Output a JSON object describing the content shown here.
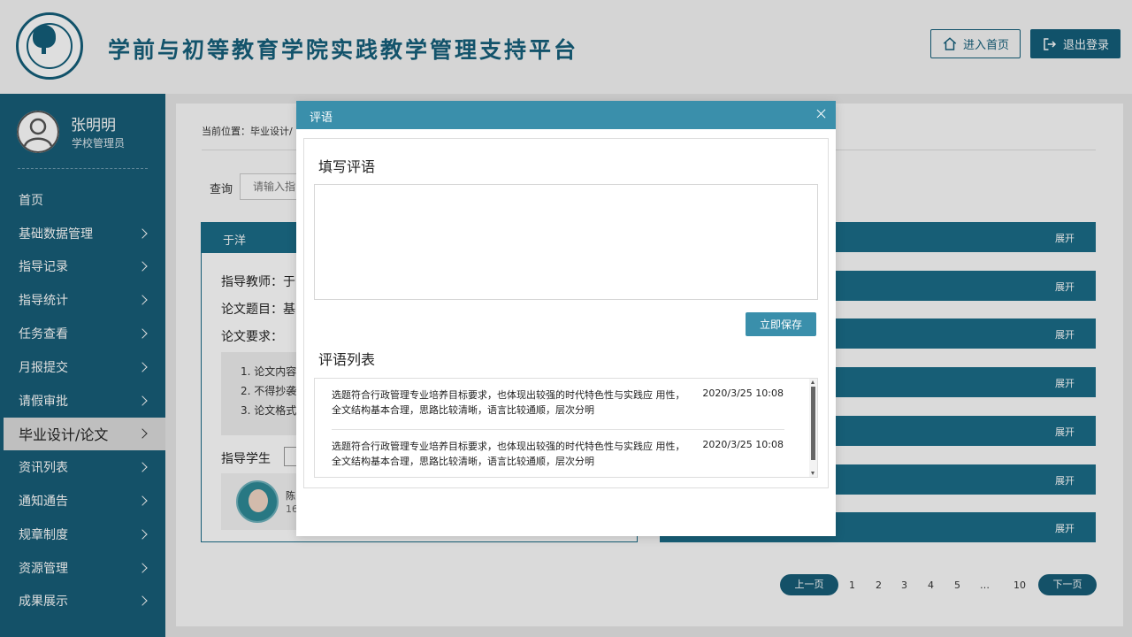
{
  "header": {
    "title": "学前与初等教育学院实践教学管理支持平台",
    "home_label": "进入首页",
    "logout_label": "退出登录"
  },
  "user": {
    "name": "张明明",
    "role": "学校管理员"
  },
  "nav": {
    "items": [
      {
        "label": "首页",
        "has_children": false,
        "active": false
      },
      {
        "label": "基础数据管理",
        "has_children": true,
        "active": false
      },
      {
        "label": "指导记录",
        "has_children": true,
        "active": false
      },
      {
        "label": "指导统计",
        "has_children": true,
        "active": false
      },
      {
        "label": "任务查看",
        "has_children": true,
        "active": false
      },
      {
        "label": "月报提交",
        "has_children": true,
        "active": false
      },
      {
        "label": "请假审批",
        "has_children": true,
        "active": false
      },
      {
        "label": "毕业设计/论文",
        "has_children": true,
        "active": true
      },
      {
        "label": "资讯列表",
        "has_children": true,
        "active": false
      },
      {
        "label": "通知通告",
        "has_children": true,
        "active": false
      },
      {
        "label": "规章制度",
        "has_children": true,
        "active": false
      },
      {
        "label": "资源管理",
        "has_children": true,
        "active": false
      },
      {
        "label": "成果展示",
        "has_children": true,
        "active": false
      }
    ]
  },
  "main": {
    "breadcrumb": "当前位置：毕业设计/",
    "query_label": "查询",
    "query_placeholder": "请输入指",
    "card": {
      "head": "于洋",
      "teacher": "指导教师：于",
      "topic": "论文题目：基",
      "requirement_label": "论文要求：",
      "requirements": [
        "1. 论文内容",
        "2. 不得抄袭",
        "3. 论文格式"
      ],
      "students_label": "指导学生",
      "student": {
        "name": "陈",
        "id": "16"
      }
    },
    "expand_label": "展开",
    "right_bar_count": 7,
    "pager": {
      "prev": "上一页",
      "next": "下一页",
      "pages": [
        "1",
        "2",
        "3",
        "4",
        "5",
        "…",
        "10"
      ]
    }
  },
  "modal": {
    "title": "评语",
    "write_title": "填写评语",
    "textarea_value": "",
    "save_label": "立即保存",
    "list_title": "评语列表",
    "comments": [
      {
        "text": "选题符合行政管理专业培养目标要求，也体现出较强的时代特色性与实践应 用性，全文结构基本合理，思路比较清晰，语言比较通顺，层次分明",
        "time": "2020/3/25 10:08"
      },
      {
        "text": "选题符合行政管理专业培养目标要求，也体现出较强的时代特色性与实践应 用性，全文结构基本合理，思路比较清晰，语言比较通顺，层次分明",
        "time": "2020/3/25 10:08"
      }
    ]
  },
  "colors": {
    "brand": "#175e78",
    "modal_accent": "#3a8fab"
  }
}
